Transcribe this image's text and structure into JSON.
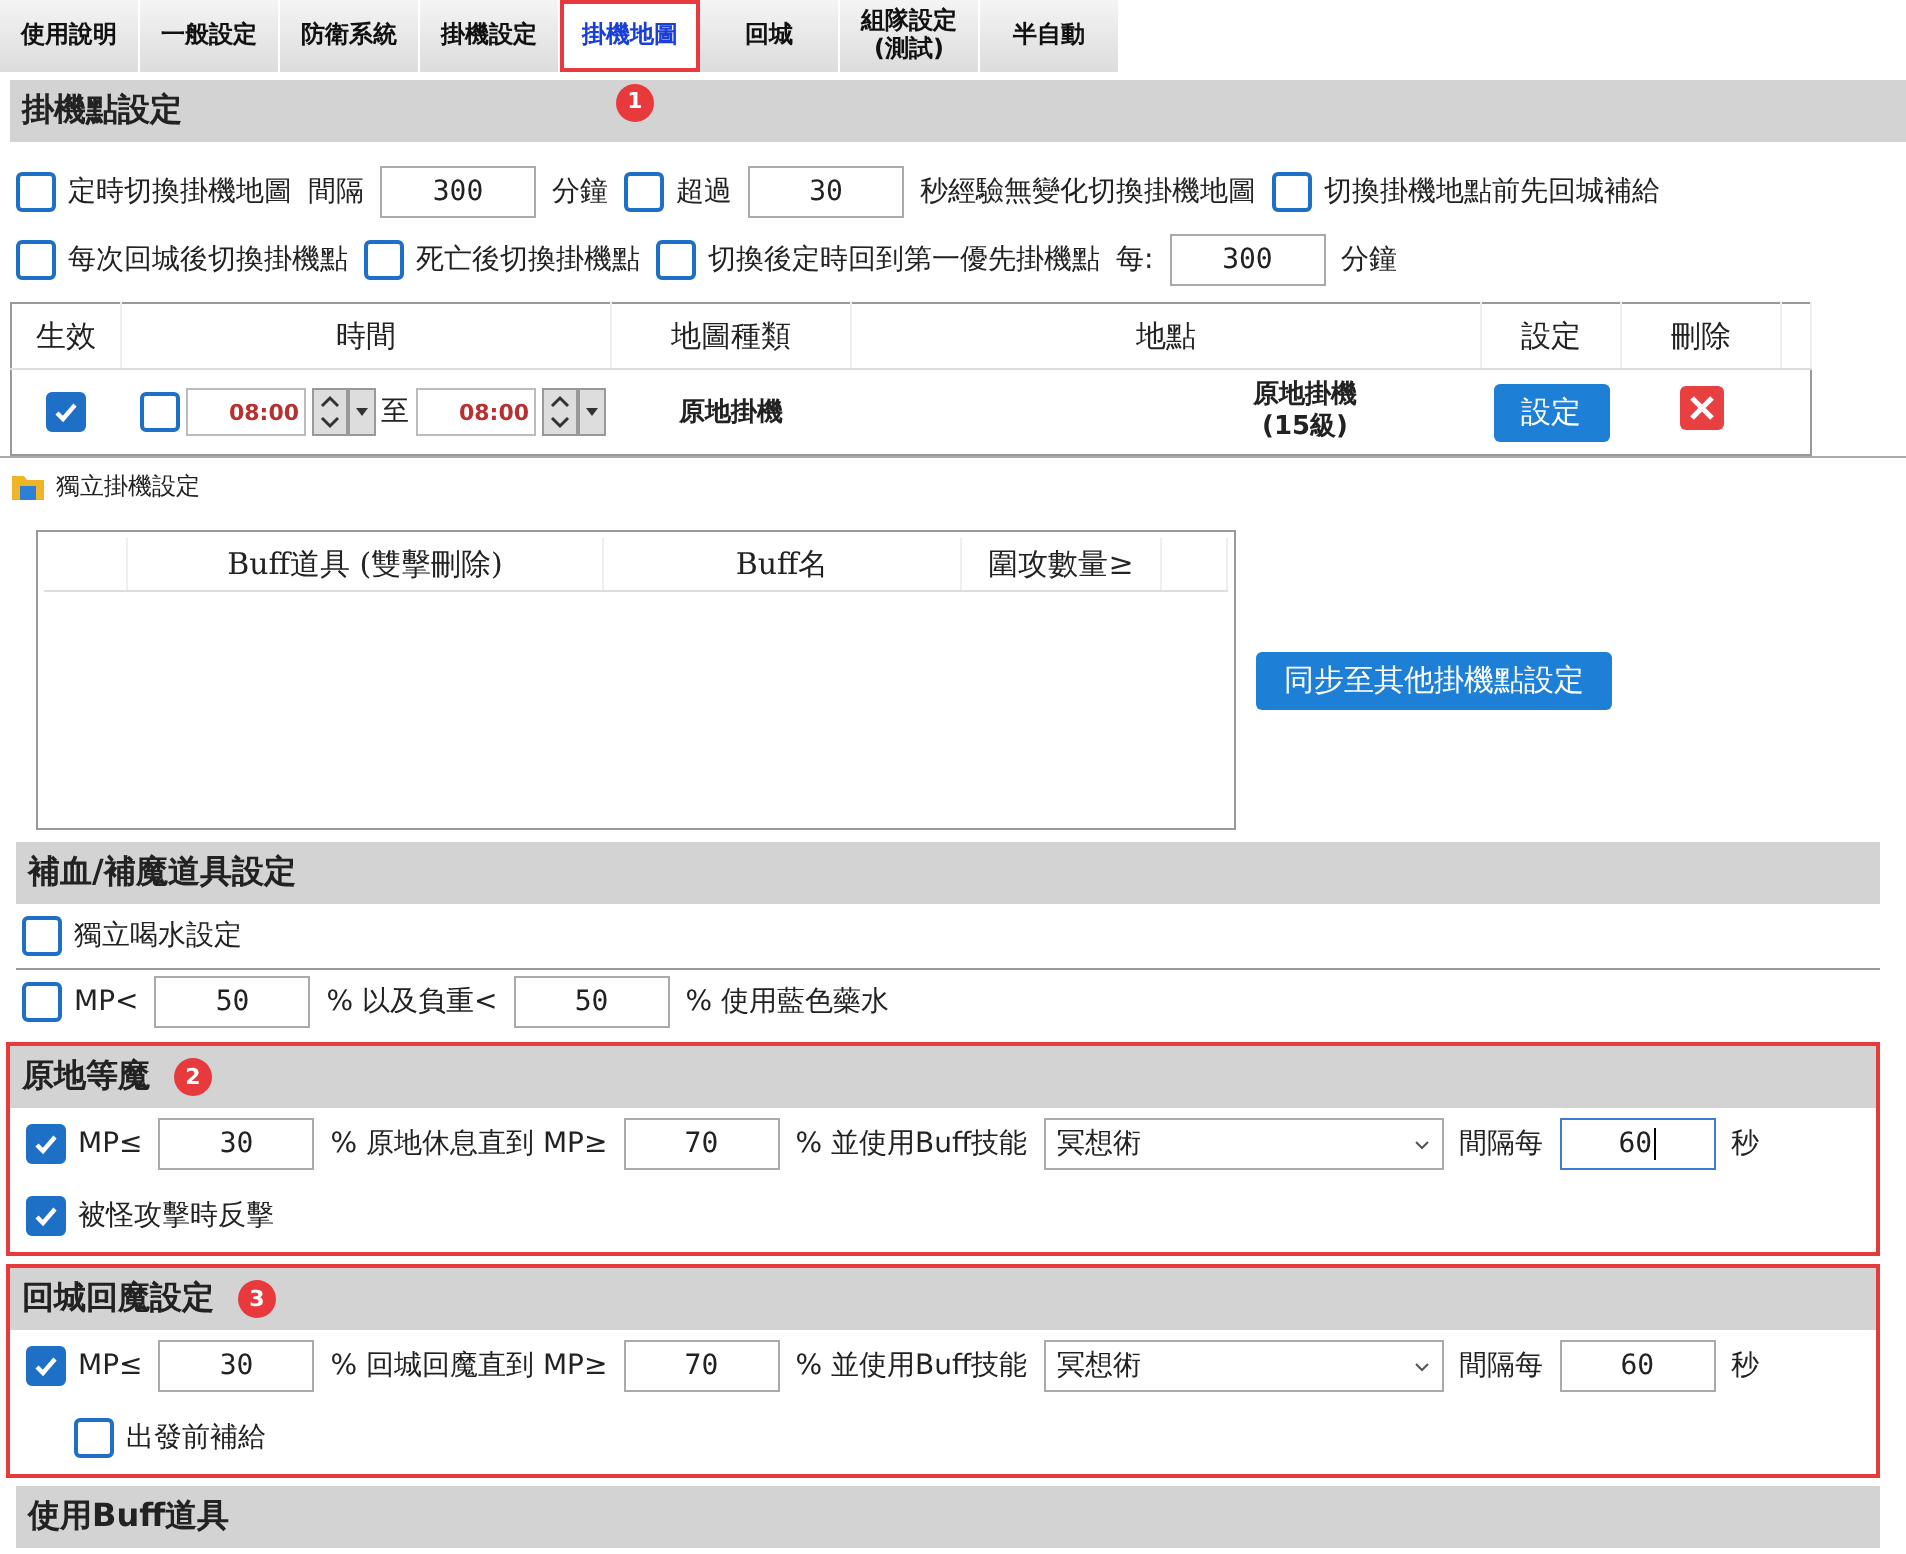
{
  "tabs": [
    {
      "label": "使用說明",
      "selected": false,
      "highlighted": false
    },
    {
      "label": "一般設定",
      "selected": false,
      "highlighted": false
    },
    {
      "label": "防衛系統",
      "selected": false,
      "highlighted": false
    },
    {
      "label": "掛機設定",
      "selected": false,
      "highlighted": false
    },
    {
      "label": "掛機地圖",
      "selected": true,
      "highlighted": true,
      "badge": "1"
    },
    {
      "label": "回城",
      "selected": false,
      "highlighted": false
    },
    {
      "label": "組隊設定\n(測試)",
      "selected": false,
      "highlighted": false
    },
    {
      "label": "半自動",
      "selected": false,
      "highlighted": false
    }
  ],
  "hang_point": {
    "title": "掛機點設定",
    "lines": [
      {
        "items": [
          {
            "kind": "checkbox",
            "label": "定時切換掛機地圖",
            "checked": false
          },
          {
            "kind": "text",
            "text": "間隔"
          },
          {
            "kind": "input",
            "value": "300"
          },
          {
            "kind": "text",
            "text": "分鐘"
          },
          {
            "kind": "checkbox",
            "label": "超過",
            "checked": false
          },
          {
            "kind": "input",
            "value": "30"
          },
          {
            "kind": "text",
            "text": "秒經驗無變化切換掛機地圖"
          },
          {
            "kind": "checkbox",
            "label": "切換掛機地點前先回城補給",
            "checked": false
          }
        ]
      },
      {
        "items": [
          {
            "kind": "checkbox",
            "label": "每次回城後切換掛機點",
            "checked": false
          },
          {
            "kind": "checkbox",
            "label": "死亡後切換掛機點",
            "checked": false
          },
          {
            "kind": "checkbox",
            "label": "切換後定時回到第一優先掛機點",
            "checked": false
          },
          {
            "kind": "text",
            "text": "每:"
          },
          {
            "kind": "input",
            "value": "300"
          },
          {
            "kind": "text",
            "text": "分鐘"
          }
        ]
      }
    ]
  },
  "table": {
    "columns": [
      "生效",
      "時間",
      "地圖種類",
      "地點",
      "設定",
      "刪除"
    ],
    "rows": [
      {
        "enabled": true,
        "time_checked": false,
        "from": "08:00",
        "separator": "至",
        "to": "08:00",
        "map_type": "原地掛機",
        "location": "原地掛機\n(15級)",
        "settings_button": "設定"
      }
    ]
  },
  "dialog": {
    "title": "獨立掛機設定",
    "buff_table": {
      "columns": [
        "Buff道具  (雙擊刪除)",
        "Buff名",
        "圍攻數量≥"
      ]
    },
    "sync_button": "同步至其他掛機點設定",
    "sections": [
      {
        "title": "補血/補魔道具設定",
        "highlighted": false,
        "lines": [
          {
            "items": [
              {
                "kind": "checkbox",
                "label": "獨立喝水設定",
                "checked": false
              }
            ]
          },
          {
            "items": [
              {
                "kind": "checkbox",
                "label": "MP<",
                "checked": false
              },
              {
                "kind": "input",
                "value": "50"
              },
              {
                "kind": "text",
                "text": "% 以及負重<"
              },
              {
                "kind": "input",
                "value": "50"
              },
              {
                "kind": "text",
                "text": "% 使用藍色藥水"
              }
            ]
          }
        ]
      },
      {
        "title": "原地等魔",
        "highlighted": true,
        "badge": "2",
        "lines": [
          {
            "items": [
              {
                "kind": "checkbox",
                "label": "MP≤",
                "checked": true
              },
              {
                "kind": "input",
                "value": "30"
              },
              {
                "kind": "text",
                "text": "% 原地休息直到 MP≥"
              },
              {
                "kind": "input",
                "value": "70"
              },
              {
                "kind": "text",
                "text": "% 並使用Buff技能"
              },
              {
                "kind": "select",
                "value": "冥想術"
              },
              {
                "kind": "text",
                "text": "間隔每"
              },
              {
                "kind": "input",
                "value": "60",
                "focused": true
              },
              {
                "kind": "text",
                "text": "秒"
              }
            ]
          },
          {
            "items": [
              {
                "kind": "checkbox",
                "label": "被怪攻擊時反擊",
                "checked": true
              }
            ]
          }
        ]
      },
      {
        "title": "回城回魔設定",
        "highlighted": true,
        "badge": "3",
        "lines": [
          {
            "items": [
              {
                "kind": "checkbox",
                "label": "MP≤",
                "checked": true
              },
              {
                "kind": "input",
                "value": "30"
              },
              {
                "kind": "text",
                "text": "% 回城回魔直到 MP≥"
              },
              {
                "kind": "input",
                "value": "70"
              },
              {
                "kind": "text",
                "text": "% 並使用Buff技能"
              },
              {
                "kind": "select",
                "value": "冥想術"
              },
              {
                "kind": "text",
                "text": "間隔每"
              },
              {
                "kind": "input",
                "value": "60",
                "focused": false
              },
              {
                "kind": "text",
                "text": "秒"
              }
            ]
          },
          {
            "items": [
              {
                "kind": "sub-checkbox",
                "label": "出發前補給",
                "checked": false
              }
            ]
          }
        ]
      },
      {
        "title": "使用Buff道具",
        "highlighted": false
      }
    ]
  }
}
